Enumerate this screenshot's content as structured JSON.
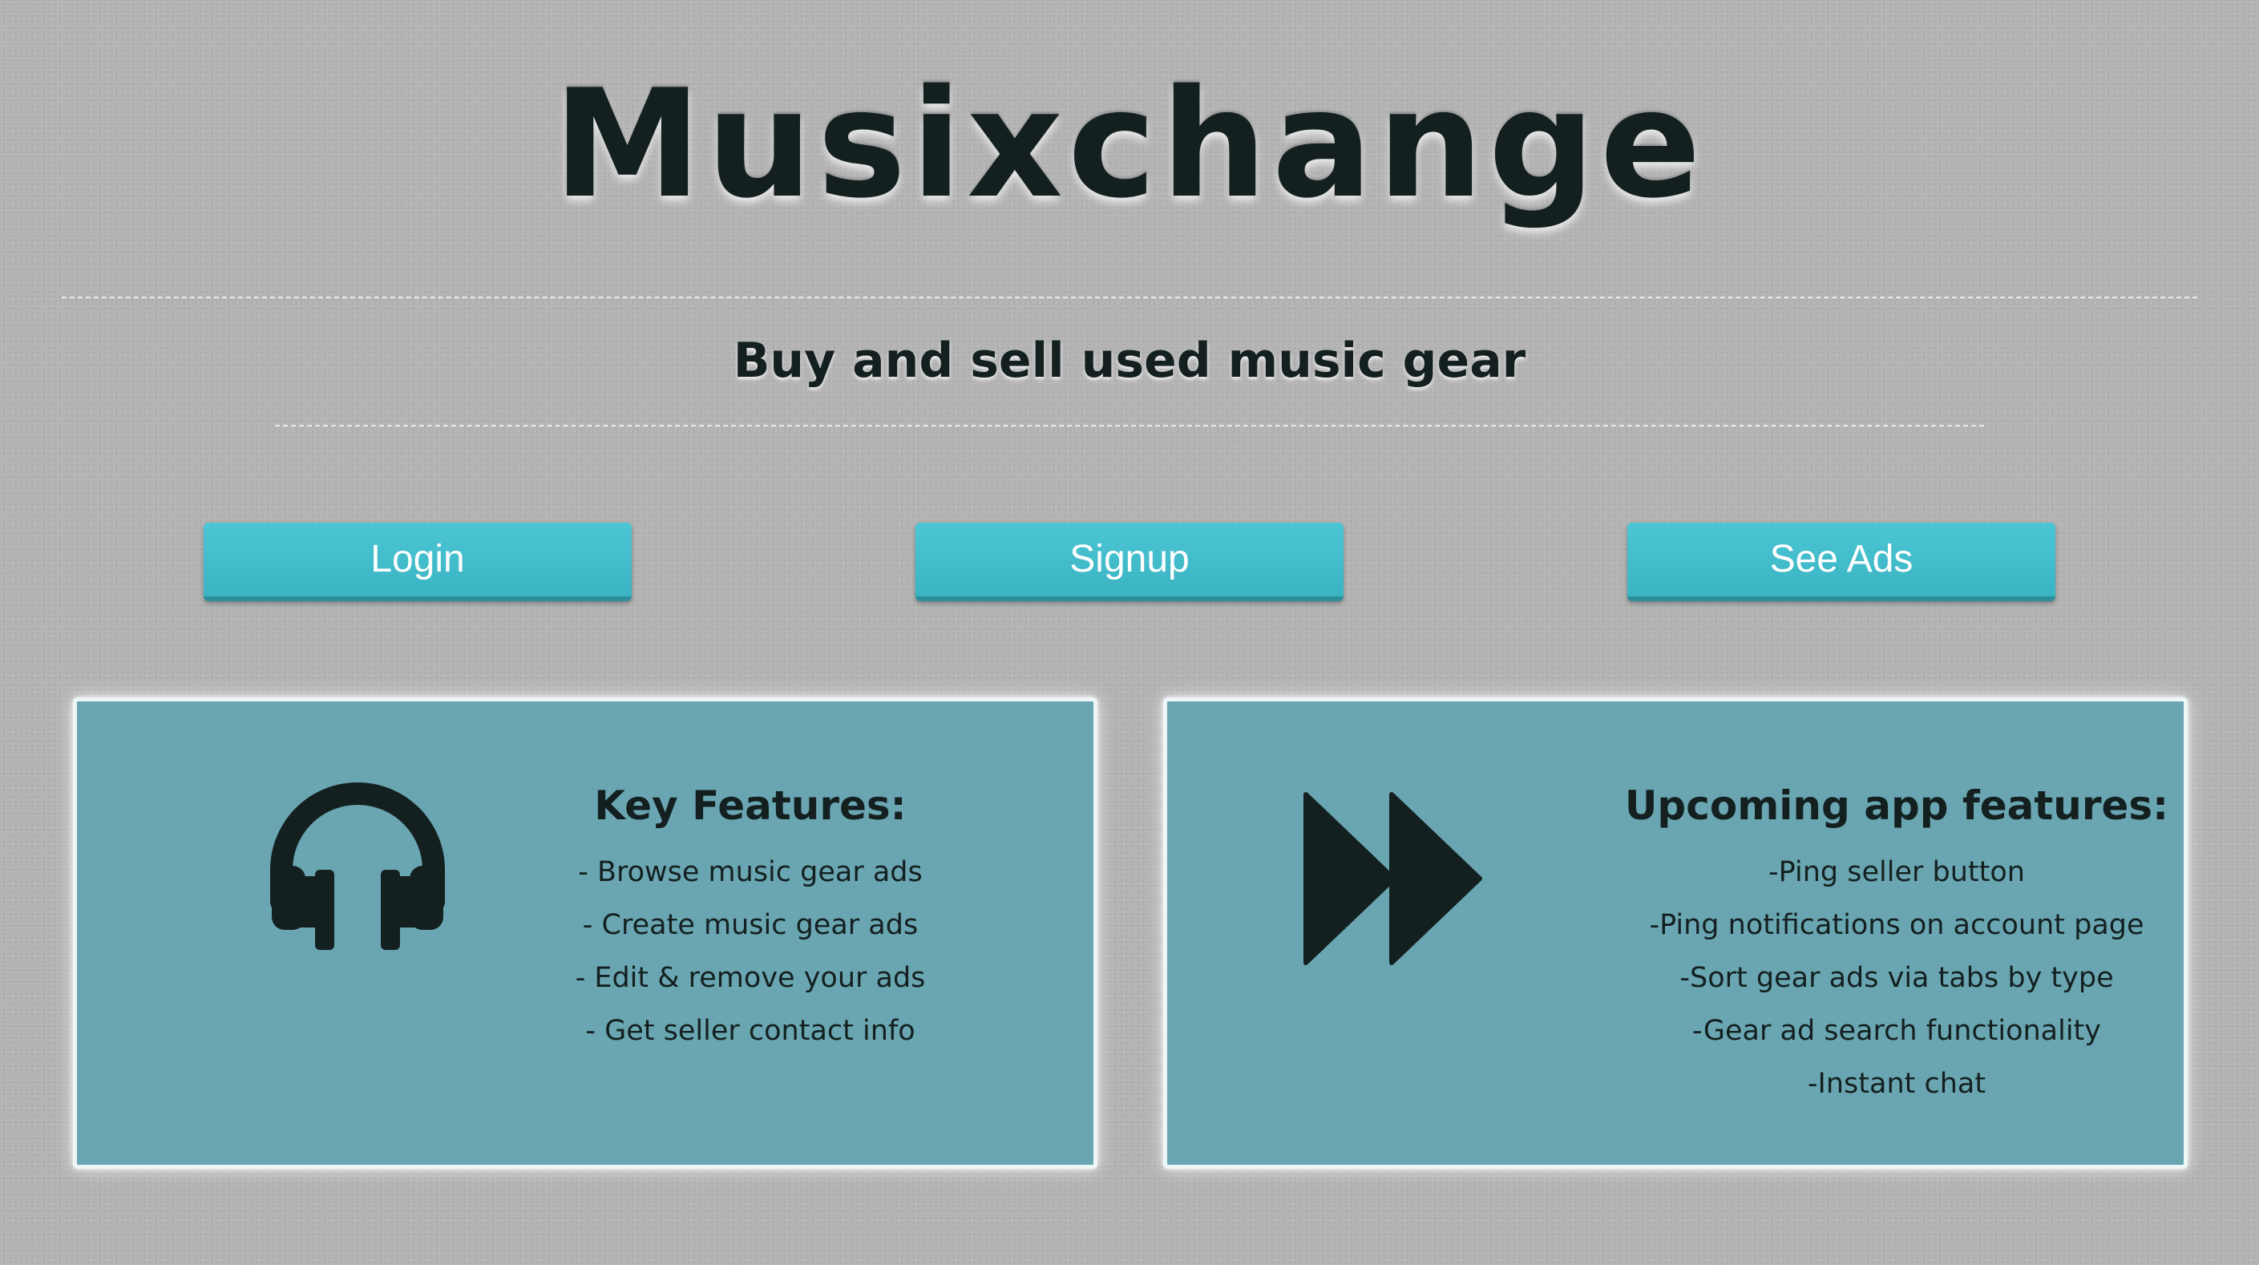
{
  "header": {
    "title": "Musixchange",
    "tagline": "Buy and sell used music gear"
  },
  "nav": {
    "login_label": "Login",
    "signup_label": "Signup",
    "see_ads_label": "See Ads"
  },
  "key_features": {
    "icon": "headphones-icon",
    "heading": "Key Features:",
    "items": [
      "- Browse music gear ads",
      "- Create music gear ads",
      "- Edit & remove your ads",
      "- Get seller contact info"
    ]
  },
  "upcoming_features": {
    "icon": "fast-forward-icon",
    "heading": "Upcoming app features:",
    "items": [
      "-Ping seller button",
      "-Ping notifications on account page",
      "-Sort gear ads via tabs by type",
      "-Gear ad search functionality",
      "-Instant chat"
    ]
  },
  "colors": {
    "background": "#b3b3b3",
    "button": "#43bfcd",
    "panel": "#6aa6b2",
    "text": "#142020"
  }
}
